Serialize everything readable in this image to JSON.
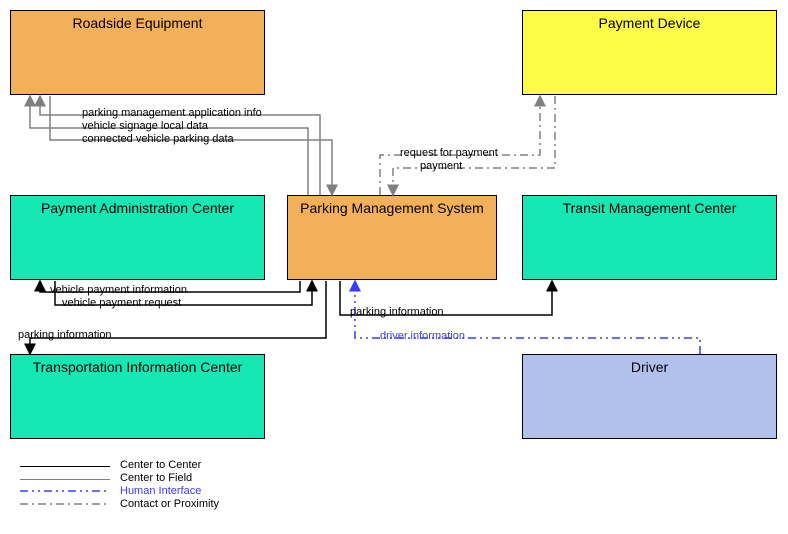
{
  "boxes": {
    "roadside": "Roadside Equipment",
    "payment_device": "Payment Device",
    "payment_admin": "Payment Administration Center",
    "pms": "Parking Management System",
    "transit": "Transit Management Center",
    "tic": "Transportation Information Center",
    "driver": "Driver"
  },
  "flows": {
    "f1": "parking management application info",
    "f2": "vehicle signage local data",
    "f3": "connected vehicle parking data",
    "f4": "request for payment",
    "f5": "payment",
    "f6": "vehicle payment information",
    "f7": "vehicle payment request",
    "f8": "parking information",
    "f9": "parking information",
    "f10": "driver information"
  },
  "legend": {
    "l1": "Center to Center",
    "l2": "Center to Field",
    "l3": "Human Interface",
    "l4": "Contact or Proximity"
  },
  "chart_data": {
    "type": "node-link-diagram",
    "nodes": [
      {
        "id": "roadside",
        "label": "Roadside Equipment",
        "category": "field"
      },
      {
        "id": "payment_device",
        "label": "Payment Device",
        "category": "device"
      },
      {
        "id": "payment_admin",
        "label": "Payment Administration Center",
        "category": "center"
      },
      {
        "id": "pms",
        "label": "Parking Management System",
        "category": "center-focus"
      },
      {
        "id": "transit",
        "label": "Transit Management Center",
        "category": "center"
      },
      {
        "id": "tic",
        "label": "Transportation Information Center",
        "category": "center"
      },
      {
        "id": "driver",
        "label": "Driver",
        "category": "human"
      }
    ],
    "edges": [
      {
        "from": "pms",
        "to": "roadside",
        "label": "parking management application info",
        "link_type": "Center to Field"
      },
      {
        "from": "pms",
        "to": "roadside",
        "label": "vehicle signage local data",
        "link_type": "Center to Field"
      },
      {
        "from": "roadside",
        "to": "pms",
        "label": "connected vehicle parking data",
        "link_type": "Center to Field"
      },
      {
        "from": "pms",
        "to": "payment_device",
        "label": "request for payment",
        "link_type": "Contact or Proximity"
      },
      {
        "from": "payment_device",
        "to": "pms",
        "label": "payment",
        "link_type": "Contact or Proximity"
      },
      {
        "from": "pms",
        "to": "payment_admin",
        "label": "vehicle payment information",
        "link_type": "Center to Center"
      },
      {
        "from": "payment_admin",
        "to": "pms",
        "label": "vehicle payment request",
        "link_type": "Center to Center"
      },
      {
        "from": "pms",
        "to": "transit",
        "label": "parking information",
        "link_type": "Center to Center"
      },
      {
        "from": "pms",
        "to": "tic",
        "label": "parking information",
        "link_type": "Center to Center"
      },
      {
        "from": "driver",
        "to": "pms",
        "label": "driver information",
        "link_type": "Human Interface"
      }
    ],
    "legend": [
      {
        "style": "solid-black",
        "label": "Center to Center"
      },
      {
        "style": "solid-gray",
        "label": "Center to Field"
      },
      {
        "style": "dash-dot-blue",
        "label": "Human Interface"
      },
      {
        "style": "dash-dot-gray",
        "label": "Contact or Proximity"
      }
    ]
  }
}
